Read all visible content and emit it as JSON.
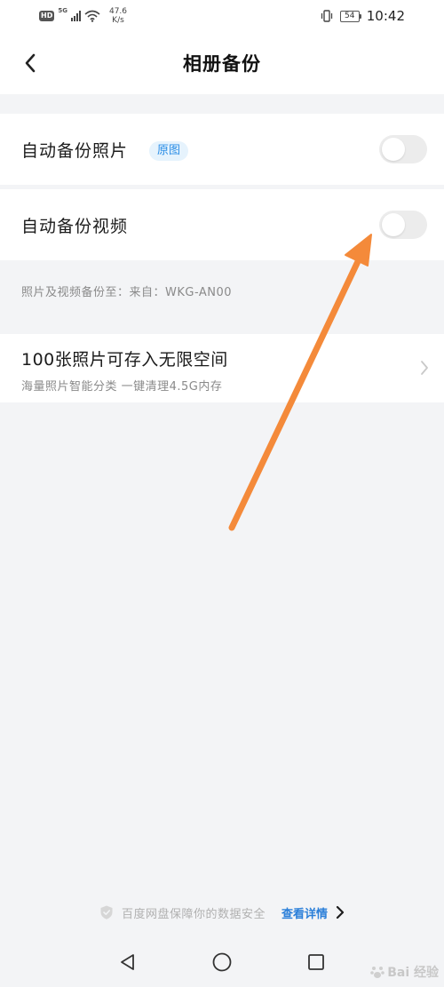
{
  "status_bar": {
    "hd": "HD",
    "network": "5G",
    "speed_value": "47.6",
    "speed_unit": "K/s",
    "battery": "54",
    "time": "10:42"
  },
  "header": {
    "title": "相册备份"
  },
  "settings": {
    "photo_label": "自动备份照片",
    "photo_tag": "原图",
    "photo_enabled": false,
    "video_label": "自动备份视频",
    "video_enabled": false
  },
  "backup_info": "照片及视频备份至：来自：WKG-AN00",
  "promo": {
    "title": "100张照片可存入无限空间",
    "subtitle": "海量照片智能分类 一键清理4.5G内存"
  },
  "footer": {
    "note": "百度网盘保障你的数据安全",
    "link": "查看详情"
  },
  "watermark": "Bai 经验",
  "colors": {
    "accent": "#2b7fd9",
    "tag_bg": "#e6f3fd",
    "annotation_arrow": "#f48a3a",
    "background": "#f3f4f6"
  },
  "icons": {
    "back": "chevron-left-icon",
    "chevron": "chevron-right-icon",
    "shield": "shield-icon",
    "nav_back": "triangle-back-icon",
    "nav_home": "circle-home-icon",
    "nav_recent": "square-recent-icon"
  }
}
